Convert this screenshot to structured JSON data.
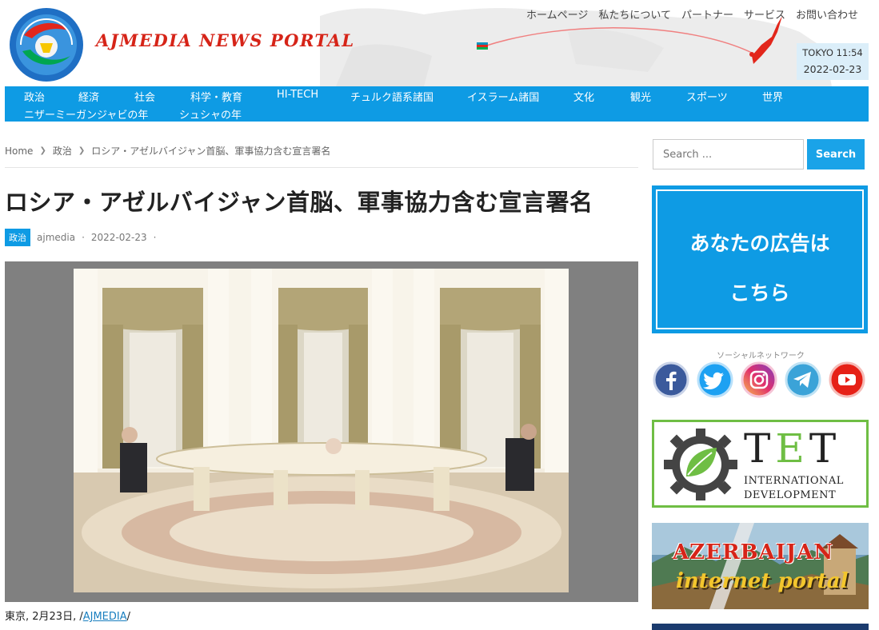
{
  "header": {
    "site_title": "AJMEDIA NEWS PORTAL",
    "top_nav": [
      "ホームページ",
      "私たちについて",
      "パートナー",
      "サービス",
      "お問い合わせ"
    ],
    "clock_city_time": "TOKYO 11:54",
    "clock_date": "2022-02-23"
  },
  "main_nav": {
    "row1": [
      "政治",
      "経済",
      "社会",
      "科学・教育",
      "HI-TECH",
      "チュルク語系諸国",
      "イスラーム諸国",
      "文化",
      "観光",
      "スポーツ",
      "世界"
    ],
    "row2": [
      "ニザーミーガンジャビの年",
      "シュシャの年"
    ]
  },
  "breadcrumb": {
    "home": "Home",
    "category": "政治",
    "current": "ロシア・アゼルバイジャン首脳、軍事協力含む宣言署名"
  },
  "article": {
    "title": "ロシア・アゼルバイジャン首脳、軍事協力含む宣言署名",
    "category": "政治",
    "author": "ajmedia",
    "date": "2022-02-23",
    "sep": "·",
    "caption_prefix": "東京, 2月23日, /",
    "caption_link": "AJMEDIA",
    "caption_suffix": "/"
  },
  "sidebar": {
    "search_placeholder": "Search ...",
    "search_button": "Search",
    "ad_line1": "あなたの広告は",
    "ad_line2": "こちら",
    "social_label": "ソーシャルネットワーク",
    "tet_title_t1": "T",
    "tet_title_e": "E",
    "tet_title_t2": "T",
    "tet_sub1": "INTERNATIONAL",
    "tet_sub2": "DEVELOPMENT",
    "az_line1": "AZERBAIJAN",
    "az_line2": "internet portal"
  },
  "colors": {
    "accent": "#0e9be4",
    "title_red": "#d62418",
    "tet_green": "#6fbe44"
  }
}
